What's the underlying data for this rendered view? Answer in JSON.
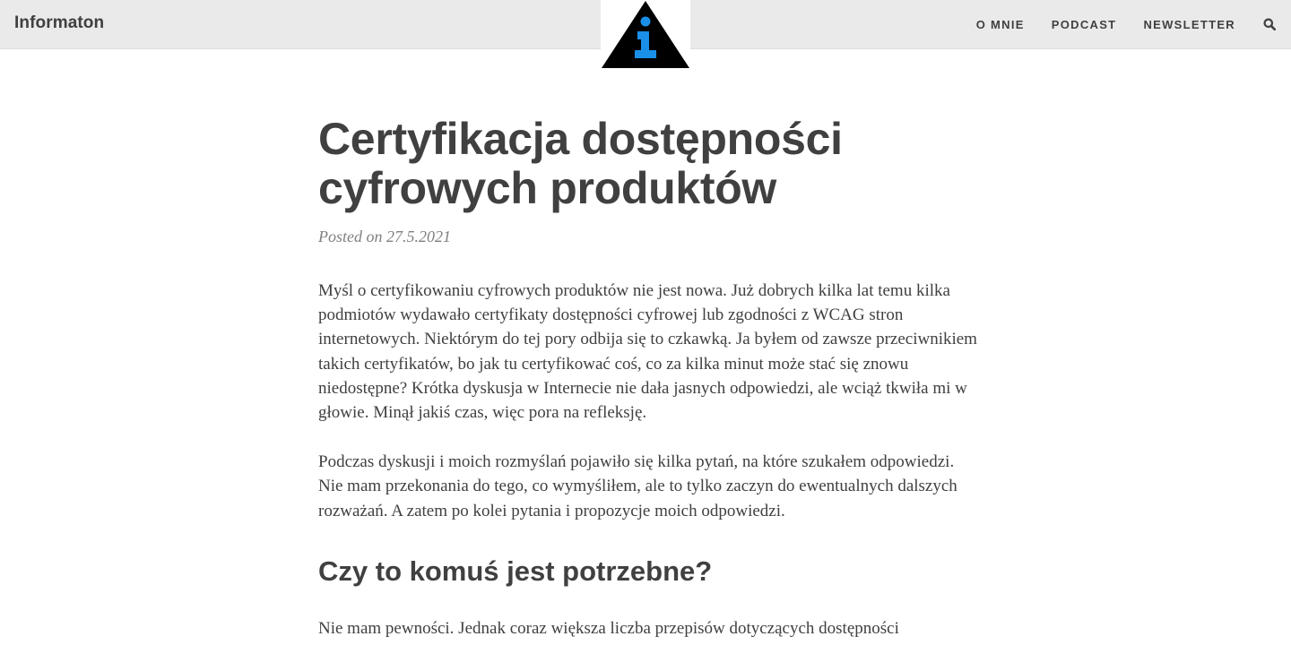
{
  "navbar": {
    "brand": "Informaton",
    "links": [
      "O MNIE",
      "PODCAST",
      "NEWSLETTER"
    ],
    "search_icon": "search-icon"
  },
  "logo": {
    "icon": "info-triangle-logo",
    "colors": {
      "triangle": "#000000",
      "glyph": "#1a8fe8"
    }
  },
  "article": {
    "title": "Certyfikacja dostępności cyfrowych produktów",
    "meta": "Posted on 27.5.2021",
    "paragraphs": [
      "Myśl o certyfikowaniu cyfrowych produktów nie jest nowa. Już dobrych kilka lat temu kilka podmiotów wydawało certyfikaty dostępności cyfrowej lub zgodności z WCAG stron internetowych. Niektórym do tej pory odbija się to czkawką. Ja byłem od zawsze przeciwnikiem takich certyfikatów, bo jak tu certyfikować coś, co za kilka minut może stać się znowu niedostępne? Krótka dyskusja w Internecie nie dała jasnych odpowiedzi, ale wciąż tkwiła mi w głowie. Minął jakiś czas, więc pora na refleksję.",
      "Podczas dyskusji i moich rozmyślań pojawiło się kilka pytań, na które szukałem odpowiedzi. Nie mam przekonania do tego, co wymyśliłem, ale to tylko zaczyn do ewentualnych dalszych rozważań. A zatem po kolei pytania i propozycje moich odpowiedzi.",
      "Nie mam pewności. Jednak coraz większa liczba przepisów dotyczących dostępności"
    ],
    "section_heading": "Czy to komuś jest potrzebne?"
  }
}
